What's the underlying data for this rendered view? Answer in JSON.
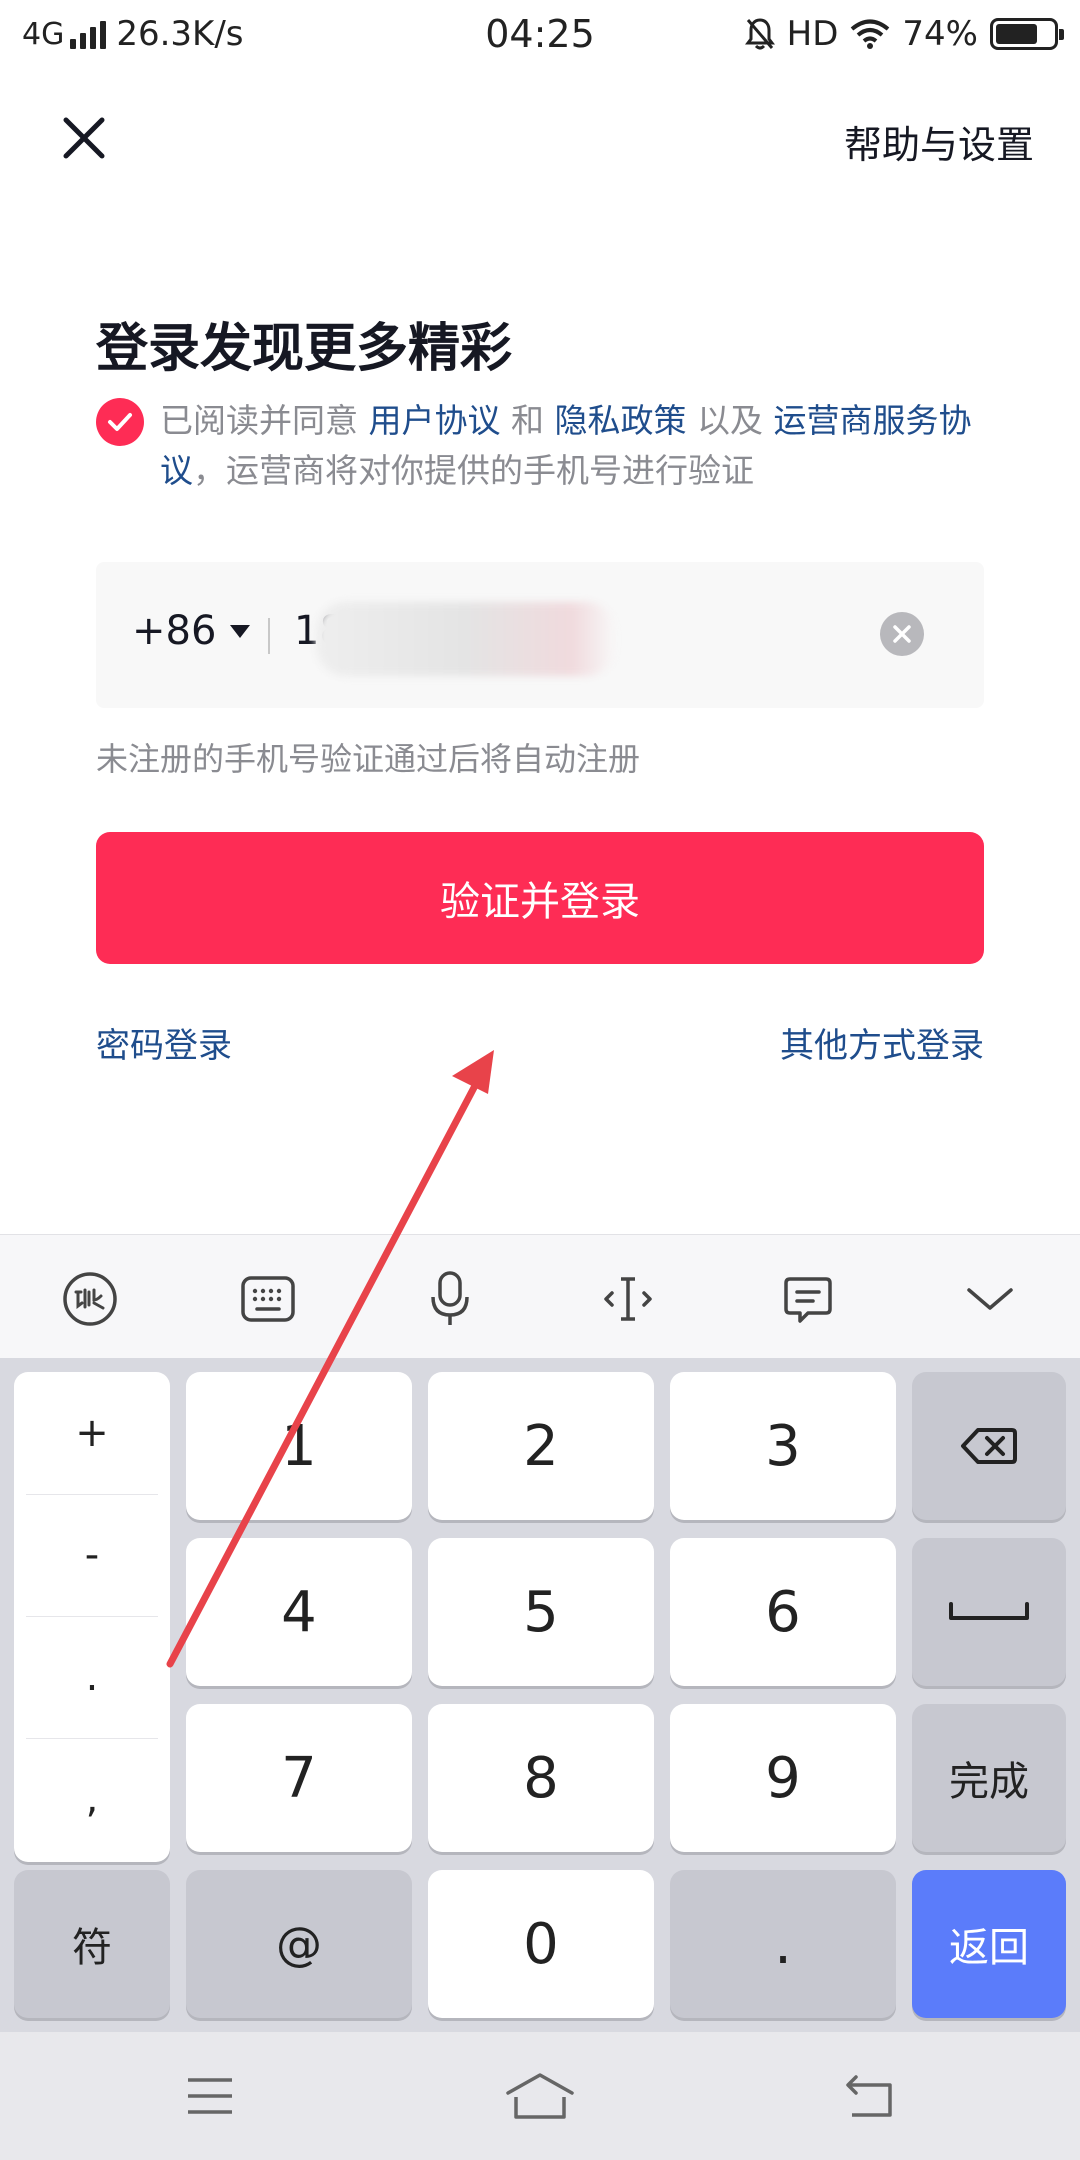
{
  "status_bar": {
    "network": "4G",
    "speed": "26.3K/s",
    "time": "04:25",
    "hd": "HD",
    "battery": "74%",
    "battery_level": 0.74
  },
  "header": {
    "help_label": "帮助与设置"
  },
  "login": {
    "title": "登录发现更多精彩",
    "agree_prefix": "已阅读并同意",
    "user_agreement": "用户协议",
    "and": "和",
    "privacy_policy": "隐私政策",
    "and_also": "以及",
    "carrier_agreement": "运营商服务协议",
    "agree_suffix": "，运营商将对你提供的手机号进行验证",
    "country_code": "+86",
    "phone_partial": "18",
    "hint": "未注册的手机号验证通过后将自动注册",
    "submit_label": "验证并登录",
    "password_login": "密码登录",
    "other_login": "其他方式登录"
  },
  "keyboard": {
    "toolbar_icons": [
      "voice-brand-icon",
      "keyboard-icon",
      "microphone-icon",
      "cursor-icon",
      "clipboard-icon",
      "collapse-icon"
    ],
    "symbols": [
      "+",
      "-",
      ".",
      ","
    ],
    "digits": [
      "1",
      "2",
      "3",
      "4",
      "5",
      "6",
      "7",
      "8",
      "9",
      "0"
    ],
    "done_label": "完成",
    "sym_label": "符",
    "at_label": "@",
    "dot_label": ".",
    "return_label": "返回"
  },
  "colors": {
    "accent": "#fe2c55",
    "link": "#1f4d8c",
    "return_key": "#5b7cfa",
    "annotation_arrow": "#e8434a"
  }
}
